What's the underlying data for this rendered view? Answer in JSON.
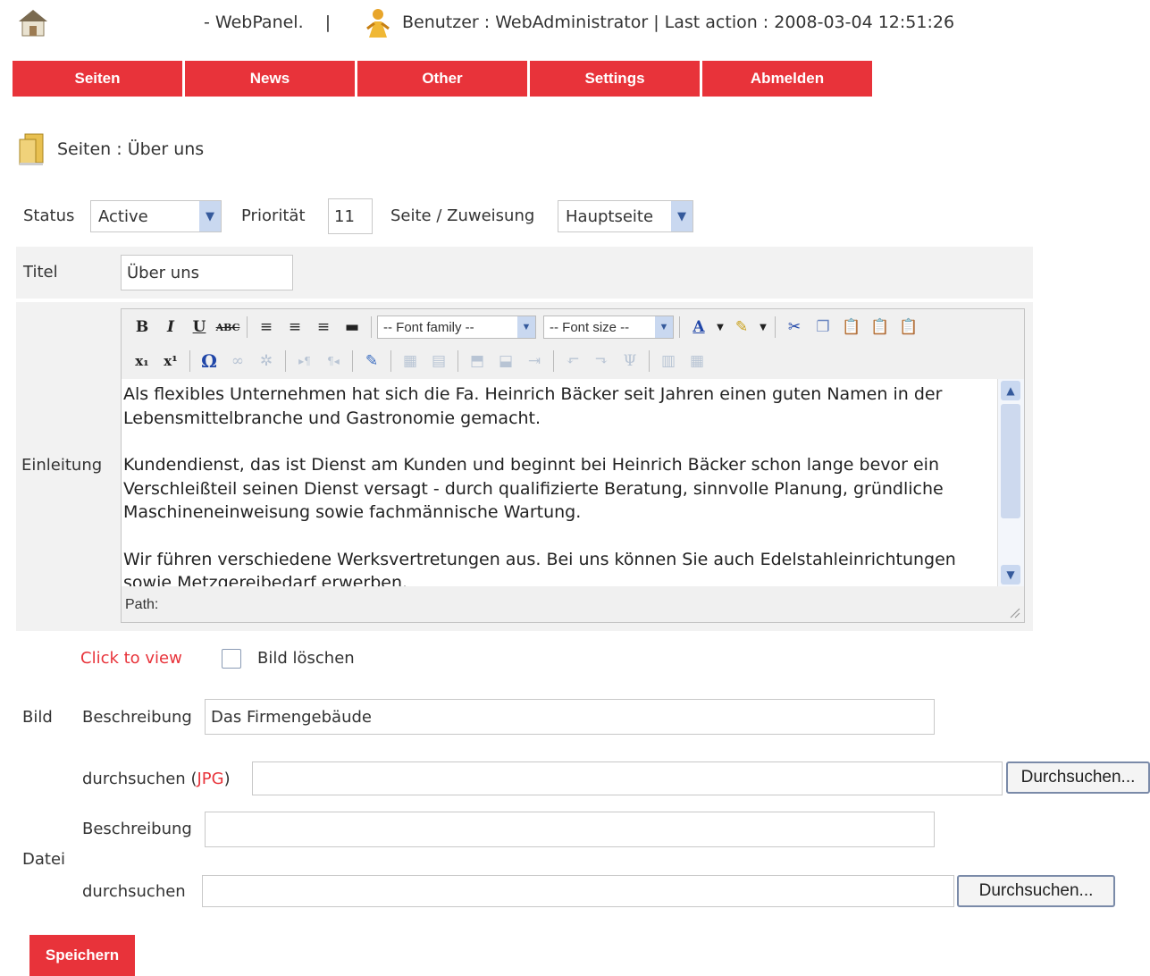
{
  "header": {
    "app_name": "- WebPanel.",
    "separator": "|",
    "user_text": "Benutzer : WebAdministrator",
    "last_action": "| Last action : 2008-03-04 12:51:26"
  },
  "nav": {
    "items": [
      {
        "label": "Seiten"
      },
      {
        "label": "News"
      },
      {
        "label": "Other"
      },
      {
        "label": "Settings"
      },
      {
        "label": "Abmelden"
      }
    ]
  },
  "breadcrumb": "Seiten : Über uns",
  "form": {
    "status_label": "Status",
    "status_value": "Active",
    "priority_label": "Priorität",
    "priority_value": "11",
    "assignment_label": "Seite / Zuweisung",
    "assignment_value": "Hauptseite",
    "title_label": "Titel",
    "title_value": "Über uns",
    "intro_label": "Einleitung",
    "image_label": "Bild",
    "click_to_view": "Click to view",
    "delete_image_label": "Bild löschen",
    "image_desc_label": "Beschreibung",
    "image_desc_value": "Das Firmengebäude",
    "image_browse_label_pre": "durchsuchen (",
    "image_browse_label_type": "JPG",
    "image_browse_label_post": ")",
    "browse_button": "Durchsuchen...",
    "file_label": "Datei",
    "file_desc_label": "Beschreibung",
    "file_browse_label": "durchsuchen",
    "file_browse_button": "Durchsuchen...",
    "save_button": "Speichern"
  },
  "editor": {
    "font_family_placeholder": "-- Font family --",
    "font_size_placeholder": "-- Font size --",
    "path_label": "Path:",
    "paragraphs": [
      "Als flexibles Unternehmen hat sich die Fa. Heinrich Bäcker seit Jahren einen guten Namen in der Lebensmittelbranche und Gastronomie gemacht.",
      "Kundendienst, das ist Dienst am Kunden und beginnt bei Heinrich Bäcker schon lange bevor ein Verschleißteil seinen Dienst versagt - durch qualifizierte Beratung, sinnvolle Planung, gründliche Maschineneinweisung sowie fachmännische Wartung.",
      "Wir führen verschiedene Werksvertretungen aus. Bei uns können Sie auch Edelstahleinrichtungen sowie Metzgereibedarf erwerben."
    ],
    "icons": [
      "bold-icon",
      "italic-icon",
      "underline-icon",
      "strikethrough-icon",
      "align-left-icon",
      "align-center-icon",
      "align-right-icon",
      "align-justify-icon",
      "font-color-icon",
      "highlight-icon",
      "cut-icon",
      "copy-icon",
      "paste-icon",
      "paste-text-icon",
      "paste-word-icon",
      "subscript-icon",
      "superscript-icon",
      "special-char-icon",
      "link-icon",
      "unlink-icon",
      "ltr-icon",
      "rtl-icon",
      "edit-source-icon",
      "table-icon"
    ]
  },
  "colors": {
    "accent": "#e8333a",
    "link": "#e8333a"
  }
}
